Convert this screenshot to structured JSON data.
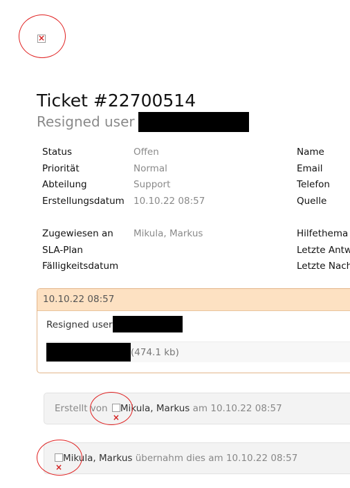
{
  "ticket": {
    "title": "Ticket #22700514",
    "subtitle": "Resigned user"
  },
  "info_left": [
    {
      "label": "Status",
      "value": "Offen"
    },
    {
      "label": "Priorität",
      "value": "Normal"
    },
    {
      "label": "Abteilung",
      "value": "Support"
    },
    {
      "label": "Erstellungsdatum",
      "value": "10.10.22 08:57"
    }
  ],
  "info_left2": [
    {
      "label": "Zugewiesen an",
      "value": "Mikula, Markus"
    },
    {
      "label": "SLA-Plan",
      "value": ""
    },
    {
      "label": "Fälligkeitsdatum",
      "value": ""
    }
  ],
  "info_right": [
    "Name",
    "Email",
    "Telefon",
    "Quelle"
  ],
  "info_right2": [
    "Hilfethema",
    "Letzte Antw",
    "Letzte Nach"
  ],
  "message": {
    "header_time": "10.10.22 08:57",
    "body": "Resigned user",
    "attachment_size": "(474.1 kb)"
  },
  "events": {
    "created_prefix": "Erstellt von",
    "created_user": "Mikula, Markus",
    "created_suffix": "am 10.10.22 08:57",
    "taken_user": "Mikula, Markus",
    "taken_suffix": "übernahm dies am 10.10.22 08:57"
  },
  "colors": {
    "annotation": "#e01f1f",
    "message_header": "#fde1c2",
    "message_border": "#e3b58a"
  }
}
